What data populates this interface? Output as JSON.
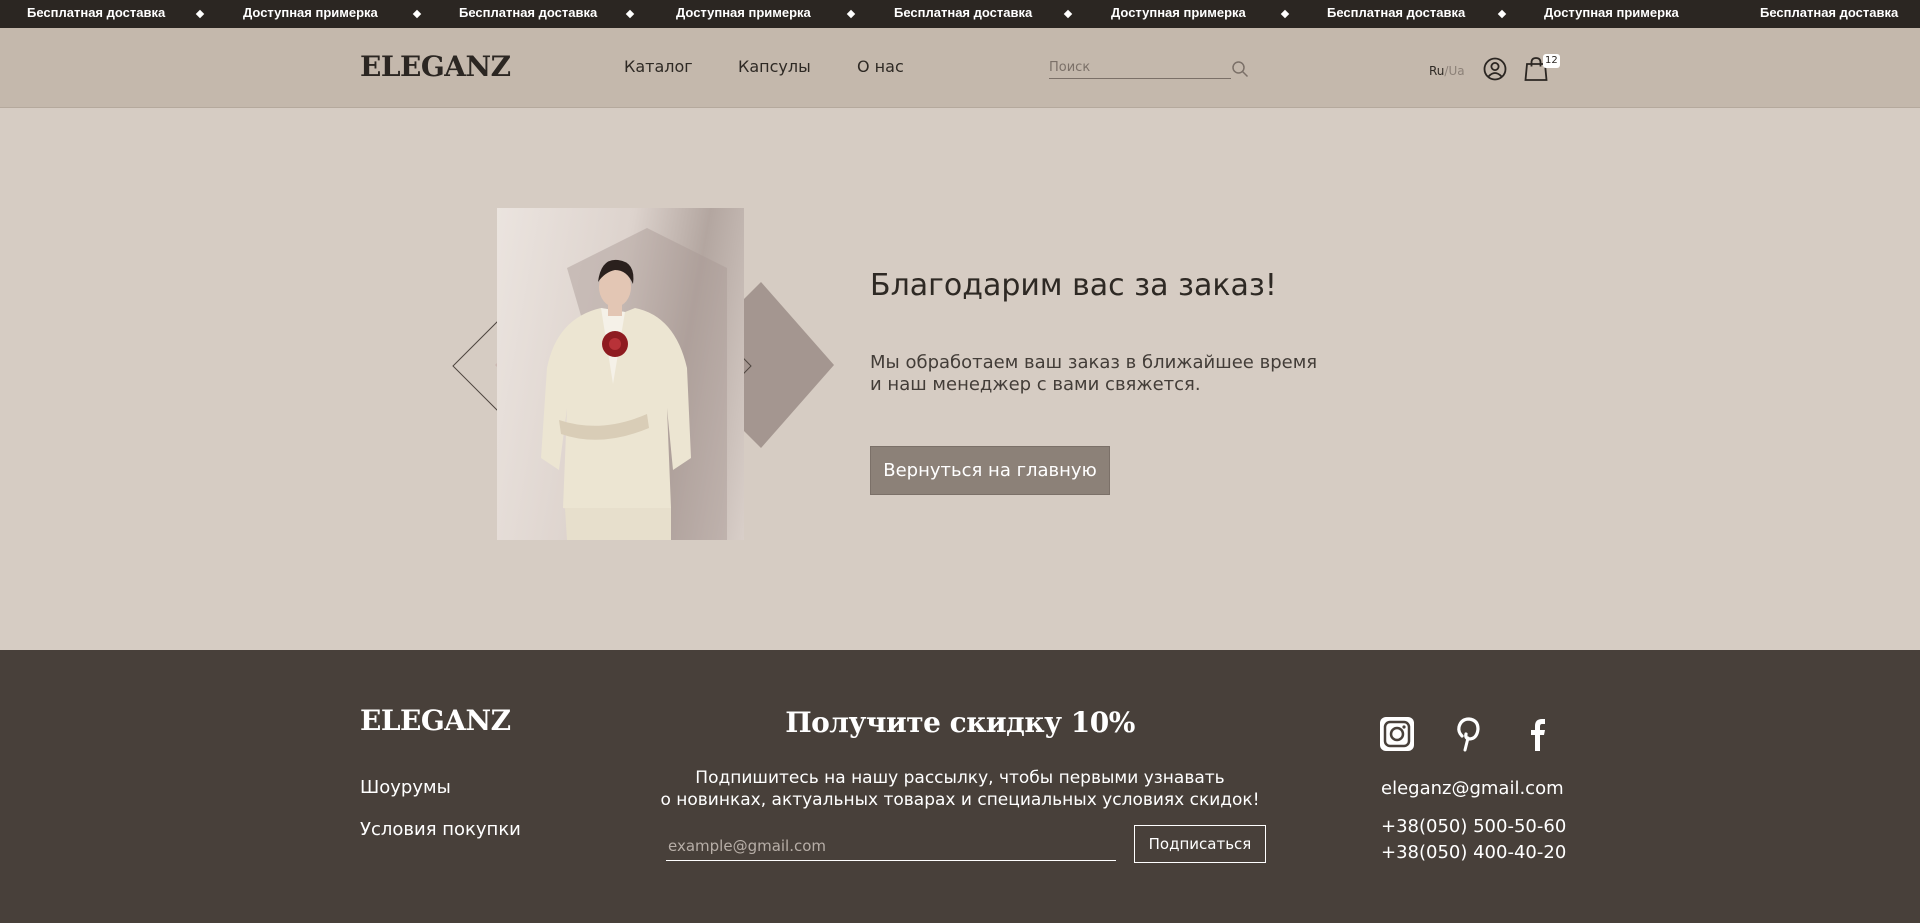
{
  "promo_bar": {
    "items": [
      "Бесплатная доставка",
      "Доступная примерка",
      "Бесплатная доставка",
      "Доступная примерка",
      "Бесплатная доставка",
      "Доступная примерка",
      "Бесплатная доставка",
      "Доступная примерка",
      "Бесплатная доставка"
    ]
  },
  "header": {
    "logo": "ELEGANZ",
    "nav": [
      "Каталог",
      "Капсулы",
      "О нас"
    ],
    "search_placeholder": "Поиск",
    "search_icon": "search-icon",
    "lang_active": "Ru",
    "lang_separator": "/",
    "lang_inactive": "Ua",
    "account_icon": "user-icon",
    "cart_icon": "shopping-bag-icon",
    "cart_count": "12"
  },
  "hero": {
    "title": "Благодарим вас за заказ!",
    "text": "Мы обработаем ваш заказ в ближайшее время\nи наш менеджер с вами свяжется.",
    "button": "Вернуться на главную"
  },
  "footer": {
    "logo": "ELEGANZ",
    "links": [
      "Шоурумы",
      "Условия покупки"
    ],
    "promo_title": "Получите скидку 10%",
    "promo_text": "Подпишитесь на нашу рассылку, чтобы первыми узнавать\nо новинках, актуальных товарах и специальных условиях скидок!",
    "email_placeholder": "example@gmail.com",
    "subscribe_button": "Подписаться",
    "social_icons": [
      "instagram-icon",
      "pinterest-icon",
      "facebook-icon"
    ],
    "contact_email": "eleganz@gmail.com",
    "phones": [
      "+38(050) 500-50-60",
      "+38(050) 400-40-20"
    ]
  },
  "colors": {
    "promo_bar": "#2b2622",
    "header": "#c4b8ac",
    "hero_bg": "#d6ccc3",
    "button": "#8c8178",
    "footer": "#48403a"
  }
}
